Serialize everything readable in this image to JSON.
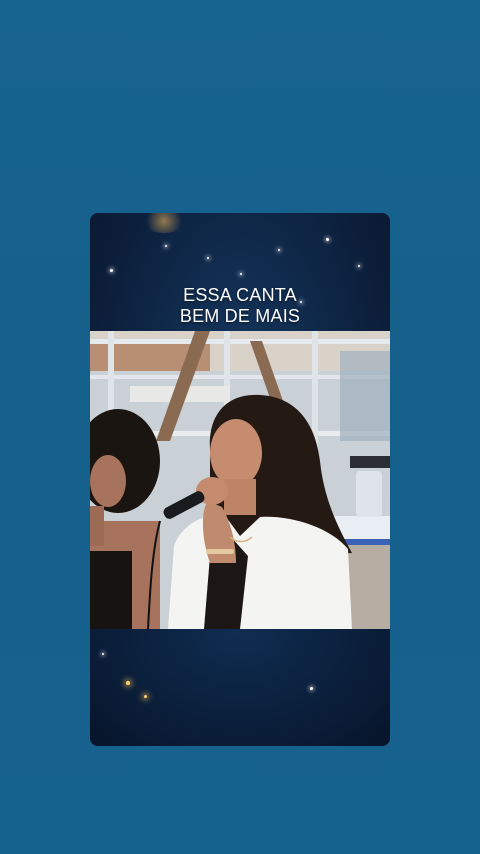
{
  "video": {
    "caption_line1": "ESSA CANTA",
    "caption_line2": "BEM DE MAIS"
  },
  "colors": {
    "page_background": "#16628f",
    "card_background": "#0d2240",
    "caption_text": "#ffffff"
  },
  "photo": {
    "description_icon": "singer-with-microphone-image"
  }
}
